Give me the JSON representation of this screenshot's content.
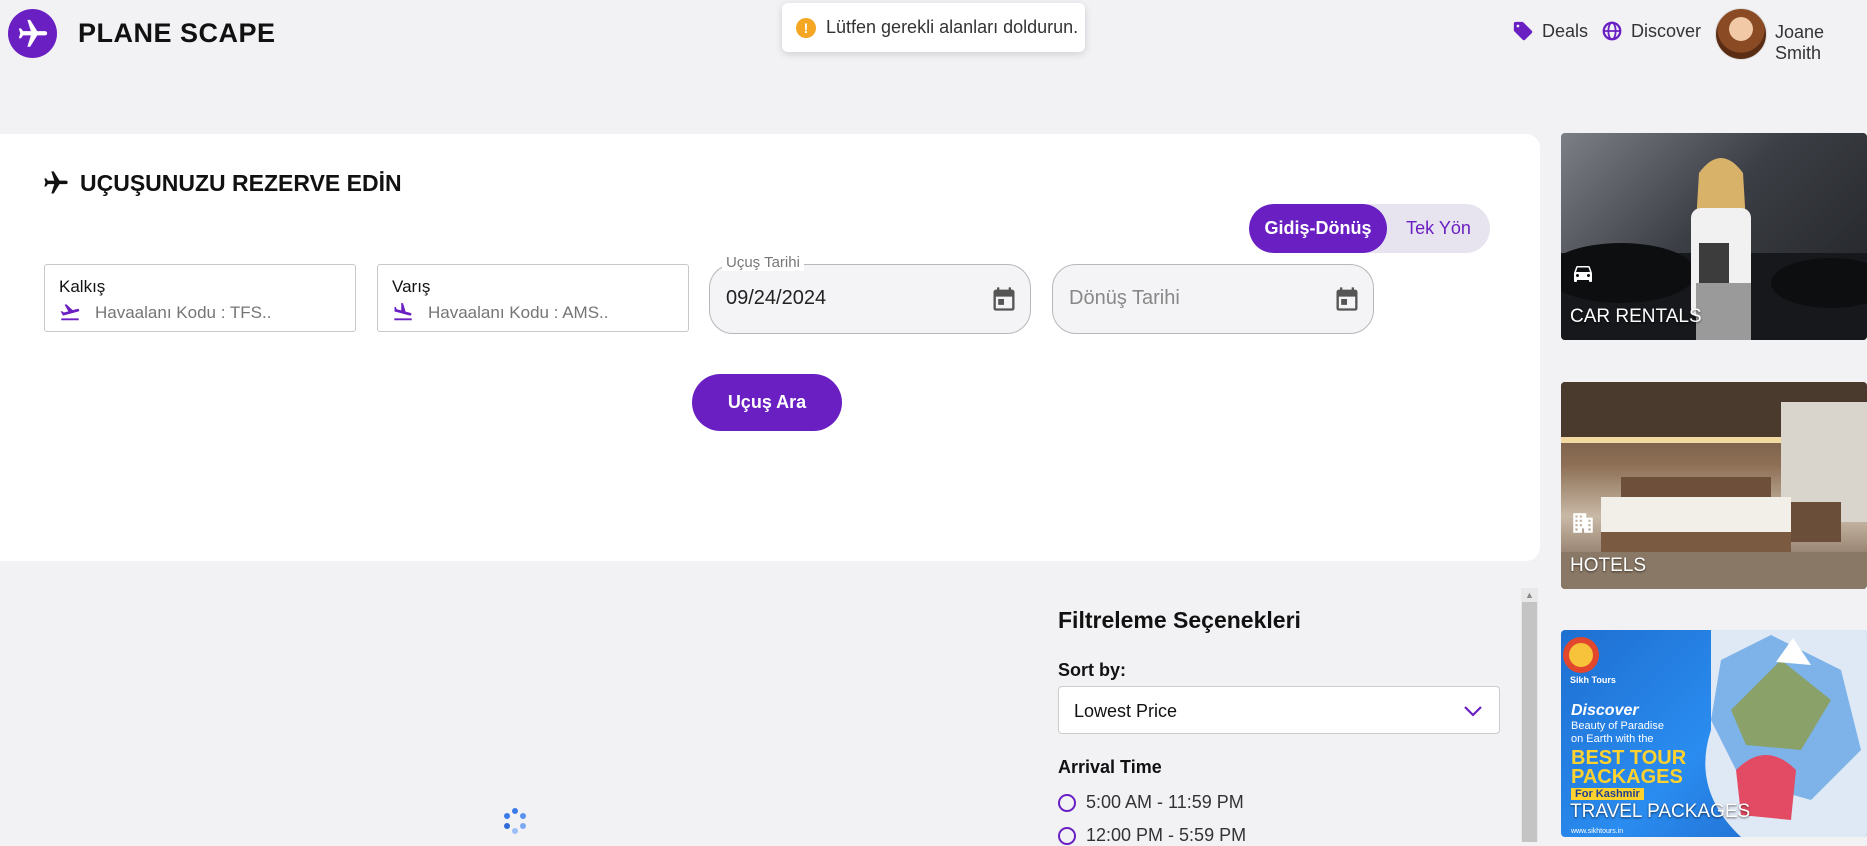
{
  "header": {
    "brand": "PLANE SCAPE",
    "nav": [
      {
        "label": "Deals",
        "icon": "tag-icon"
      },
      {
        "label": "Discover",
        "icon": "globe-icon"
      }
    ],
    "user": {
      "name": "Joane Smith"
    }
  },
  "toast": {
    "message": "Lütfen gerekli alanları doldurun.",
    "icon": "warning-icon"
  },
  "booking": {
    "title": "UÇUŞUNUZU REZERVE EDİN",
    "trip_type": {
      "options": [
        "Gidiş-Dönüş",
        "Tek Yön"
      ],
      "selected": "Gidiş-Dönüş"
    },
    "departure": {
      "label": "Kalkış",
      "placeholder": "Havaalanı Kodu : TFS..",
      "value": ""
    },
    "arrival": {
      "label": "Varış",
      "placeholder": "Havaalanı Kodu : AMS..",
      "value": ""
    },
    "flight_date": {
      "label": "Uçuş Tarihi",
      "value": "09/24/2024"
    },
    "return_date": {
      "placeholder": "Dönüş Tarihi",
      "value": ""
    },
    "search_label": "Uçuş Ara"
  },
  "filters": {
    "title": "Filtreleme Seçenekleri",
    "sort_label": "Sort by:",
    "sort_value": "Lowest Price",
    "arrival_label": "Arrival Time",
    "arrival_options": [
      "5:00 AM - 11:59 PM",
      "12:00 PM - 5:59 PM"
    ]
  },
  "side_cards": [
    {
      "label": "CAR RENTALS",
      "icon": "car-icon"
    },
    {
      "label": "HOTELS",
      "icon": "building-icon"
    },
    {
      "label": "TRAVEL PACKAGES",
      "icon": "walking-icon"
    }
  ],
  "promo": {
    "brand": "Sikh Tours",
    "line1": "Discover",
    "line2": "Beauty of Paradise",
    "line3": "on Earth with the",
    "line4": "BEST TOUR",
    "line5": "PACKAGES",
    "line6": "For Kashmir",
    "url": "www.sikhtours.in"
  },
  "colors": {
    "accent": "#6a1fc2",
    "toast_warning": "#f5a623"
  }
}
